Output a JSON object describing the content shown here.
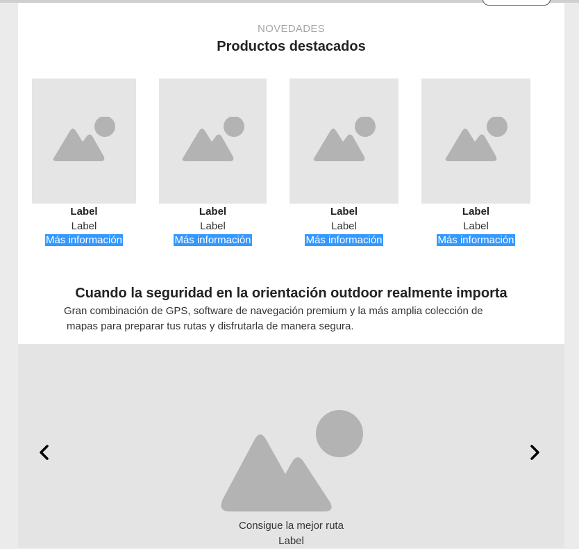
{
  "featured": {
    "eyebrow": "NOVEDADES",
    "title": "Productos destacados",
    "cards": [
      {
        "title": "Label",
        "subtitle": "Label",
        "link": "Más información"
      },
      {
        "title": "Label",
        "subtitle": "Label",
        "link": "Más información"
      },
      {
        "title": "Label",
        "subtitle": "Label",
        "link": "Más información"
      },
      {
        "title": "Label",
        "subtitle": "Label",
        "link": "Más información"
      }
    ]
  },
  "intro": {
    "title": "Cuando la seguridad en la orientación outdoor realmente importa",
    "body_line1": "Gran combinación de GPS, software de navegación premium y la más amplia colección de",
    "body_line2": "mapas para preparar tus rutas y disfrutarla de manera segura."
  },
  "hero": {
    "caption": "Consigue la mejor ruta",
    "label": "Label",
    "prev_icon": "chevron-left-icon",
    "next_icon": "chevron-right-icon",
    "image_icon": "image-placeholder-icon"
  },
  "colors": {
    "link_highlight": "#3399ff",
    "placeholder_bg": "#e5e5e5",
    "placeholder_shape": "#b3b3b3"
  }
}
